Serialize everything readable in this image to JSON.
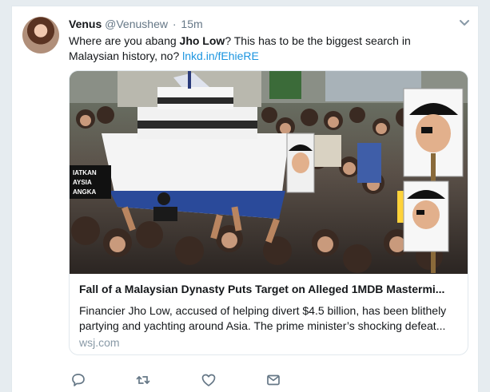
{
  "tweet": {
    "author_name": "Venus",
    "author_handle": "@Venushew",
    "separator": "·",
    "time": "15m",
    "text_before": "Where are you abang ",
    "text_bold": "Jho Low",
    "text_after": "? This has to be the biggest search in Malaysian history, no? ",
    "link_text": "lnkd.in/fEhieRE"
  },
  "card": {
    "title": "Fall of a Malaysian Dynasty Puts Target on Alleged 1MDB Mastermi...",
    "description": "Financier Jho Low, accused of helping divert $4.5 billion, has been blithely partying and yachting around Asia. The prime minister’s shocking defeat...",
    "domain": "wsj.com",
    "photo_text": {
      "banner_line1": "IATKAN",
      "banner_line2": "AYSIA",
      "banner_line3": "ANGKA"
    }
  },
  "icons": {
    "caret": "chevron-down-icon",
    "reply": "reply-icon",
    "retweet": "retweet-icon",
    "like": "heart-icon",
    "message": "envelope-icon"
  },
  "colors": {
    "link": "#1b95e0",
    "muted": "#657786",
    "icon": "#657786",
    "domain": "#8899a6"
  }
}
